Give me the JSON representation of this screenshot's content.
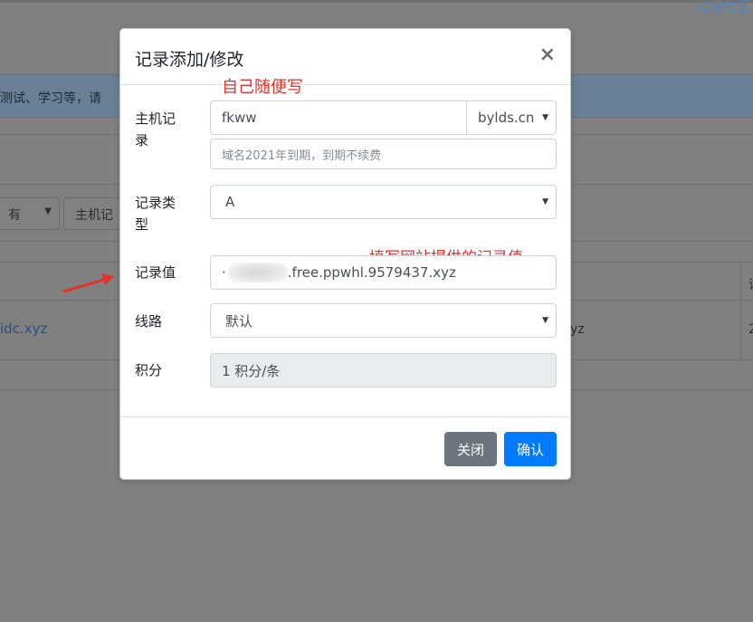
{
  "background": {
    "top_link": "站盛社区",
    "alert_text": "测试、学习等，请",
    "filter_select_1": "有",
    "filter_select_2": "主机记",
    "table_link": "idc.xyz",
    "table_cell": "yz",
    "col_text_1": "请",
    "col_text_2": "2"
  },
  "modal": {
    "title": "记录添加/修改",
    "close_symbol": "×",
    "host_record": {
      "label_line1": "主机记",
      "label_line2": "录",
      "value": "fkww",
      "domain_selected": "bylds.cn",
      "hint_placeholder": "域名2021年到期，到期不续费"
    },
    "record_type": {
      "label_line1": "记录类",
      "label_line2": "型",
      "value": "A"
    },
    "record_value": {
      "label": "记录值",
      "value_prefix": "·",
      "value_suffix": ".free.ppwhl.9579437.xyz"
    },
    "line": {
      "label": "线路",
      "value": "默认"
    },
    "points": {
      "label": "积分",
      "value": "1 积分/条"
    },
    "footer": {
      "close_label": "关闭",
      "confirm_label": "确认"
    }
  },
  "annotations": {
    "host_note": "自己随便写",
    "value_note": "填写网站提供的记录值",
    "arrow_color": "#e0322e"
  },
  "colors": {
    "primary": "#007bff",
    "secondary": "#6c757d",
    "overlay": "#808080"
  }
}
